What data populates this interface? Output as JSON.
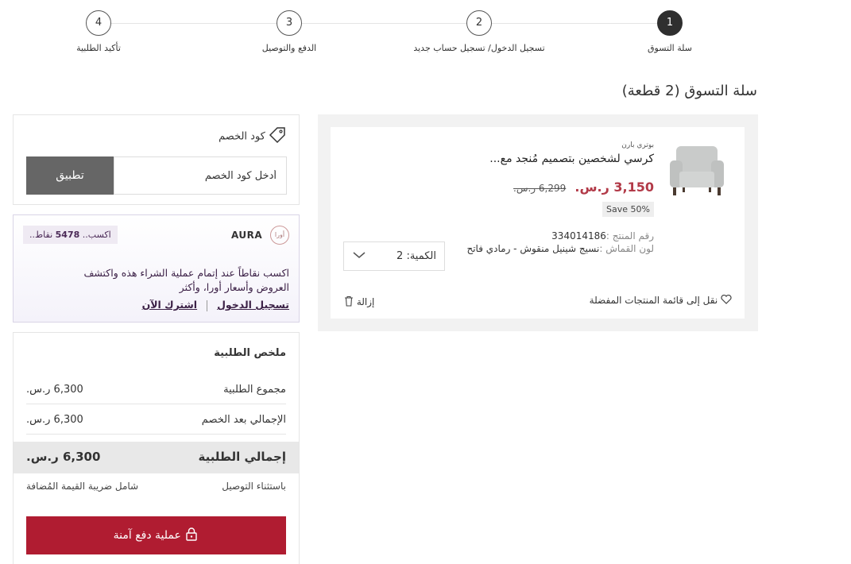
{
  "stepper": {
    "steps": [
      {
        "number": "1",
        "label": "سلة التسوق"
      },
      {
        "number": "2",
        "label": "تسجيل الدخول/ تسجيل حساب جديد"
      },
      {
        "number": "3",
        "label": "الدفع والتوصيل"
      },
      {
        "number": "4",
        "label": "تأكيد الطلبية"
      }
    ]
  },
  "cart": {
    "title": "سلة التسوق (2 قطعة)",
    "item": {
      "brand": "بوتري بارن",
      "name": "كرسي لشخصين بتصميم مُنجد مع...",
      "price": "3,150 ر.س.",
      "old_price": "6,299 ر.س.",
      "save": "Save 50%",
      "sku_label": "رقم المنتج :",
      "sku": "334014186",
      "fabric_label": "لون القماش :",
      "fabric": "نسيج شينيل منقوش - رمادي فاتح",
      "quantity_label": "الكمية: 2",
      "wishlist_label": "نقل إلى قائمة المنتجات المفضلة",
      "remove_label": "إزالة"
    }
  },
  "coupon": {
    "title": "كود الخصم",
    "placeholder": "أدخل كود الخصم",
    "apply_label": "تطبيق"
  },
  "aura": {
    "brand": "AURA",
    "logo_text": "أورا",
    "points_prefix": "اكسب..",
    "points_value": "5478",
    "points_suffix": "نقاط..",
    "message": "اكسب نقاطاً عند إتمام عملية الشراء هذه واكتشف العروض وأسعار أورا، وأكثر",
    "login_link": "تسجيل الدخول",
    "signup_link": "اشترك الآن"
  },
  "summary": {
    "title": "ملخص الطلبية",
    "subtotal_label": "مجموع الطلبية",
    "subtotal_value": "6,300 ر.س.",
    "after_discount_label": "الإجمالي بعد الخصم",
    "after_discount_value": "6,300 ر.س.",
    "total_label": "إجمالي الطلبية",
    "total_value": "6,300 ر.س.",
    "delivery_note": "باستثناء التوصيل",
    "vat_note": "شامل ضريبة القيمة المُضافة",
    "checkout_label": "عملية دفع آمنة"
  },
  "colors": {
    "accent": "#b01c31",
    "sale_price": "#b23a48",
    "aura_purple": "#3b2046"
  }
}
